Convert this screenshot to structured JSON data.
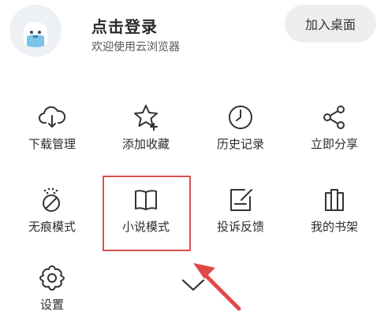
{
  "header": {
    "login_title": "点击登录",
    "login_subtitle": "欢迎使用云浏览器",
    "add_desktop_label": "加入桌面"
  },
  "menu": {
    "items": [
      {
        "label": "下载管理",
        "icon": "cloud-download-icon"
      },
      {
        "label": "添加收藏",
        "icon": "star-add-icon"
      },
      {
        "label": "历史记录",
        "icon": "clock-icon"
      },
      {
        "label": "立即分享",
        "icon": "share-icon"
      },
      {
        "label": "无痕模式",
        "icon": "incognito-icon"
      },
      {
        "label": "小说模式",
        "icon": "open-book-icon"
      },
      {
        "label": "投诉反馈",
        "icon": "edit-feedback-icon"
      },
      {
        "label": "我的书架",
        "icon": "bookshelf-icon"
      },
      {
        "label": "设置",
        "icon": "gear-icon"
      }
    ]
  },
  "colors": {
    "highlight": "#d9534f",
    "arrow": "#e04848",
    "icon_stroke": "#333333",
    "button_bg": "#eeeeee"
  }
}
